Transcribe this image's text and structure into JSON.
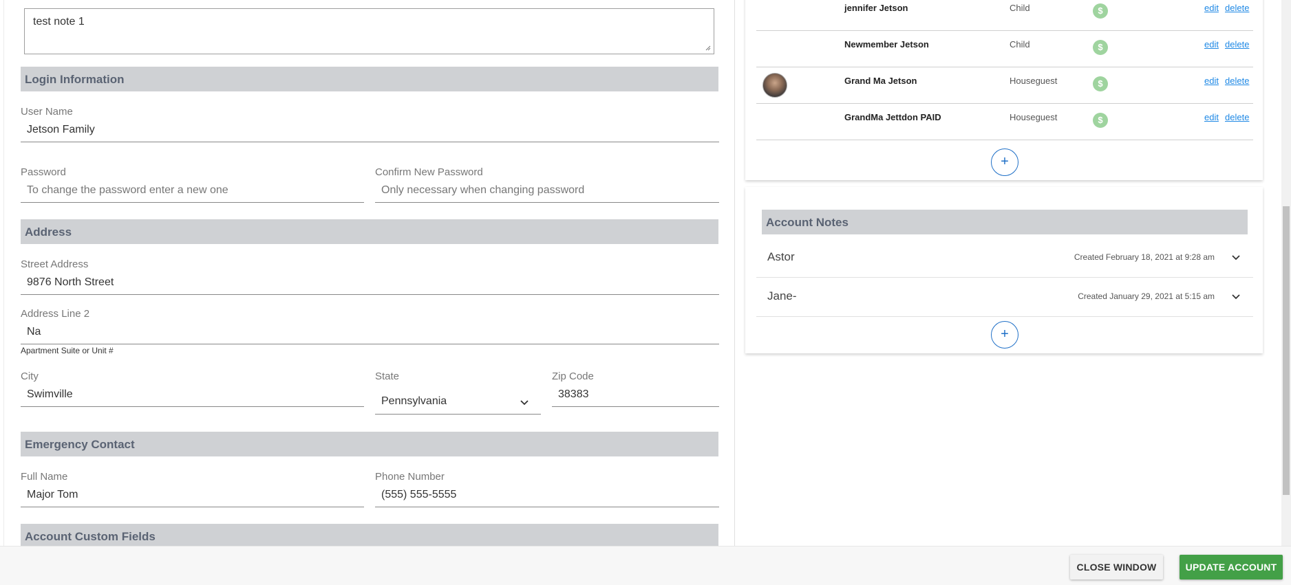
{
  "notes_textarea": {
    "value": "test note 1"
  },
  "login_section": {
    "title": "Login Information",
    "username_label": "User Name",
    "username_value": "Jetson Family",
    "password_label": "Password",
    "password_placeholder": "To change the password enter a new one",
    "confirm_label": "Confirm New Password",
    "confirm_placeholder": "Only necessary when changing password"
  },
  "address_section": {
    "title": "Address",
    "street_label": "Street Address",
    "street_value": "9876 North Street",
    "line2_label": "Address Line 2",
    "line2_value": "Na",
    "line2_hint": "Apartment Suite or Unit #",
    "city_label": "City",
    "city_value": "Swimville",
    "state_label": "State",
    "state_value": "Pennsylvania",
    "zip_label": "Zip Code",
    "zip_value": "38383"
  },
  "emergency_section": {
    "title": "Emergency Contact",
    "name_label": "Full Name",
    "name_value": "Major Tom",
    "phone_label": "Phone Number",
    "phone_value": "(555) 555-5555"
  },
  "custom_section": {
    "title": "Account Custom Fields"
  },
  "members": [
    {
      "name": "jennifer Jetson",
      "role": "Child",
      "pay_icon": "$",
      "edit": "edit",
      "delete": "delete",
      "avatar": false
    },
    {
      "name": "Newmember Jetson",
      "role": "Child",
      "pay_icon": "$",
      "edit": "edit",
      "delete": "delete",
      "avatar": false
    },
    {
      "name": "Grand Ma Jetson",
      "role": "Houseguest",
      "pay_icon": "$",
      "edit": "edit",
      "delete": "delete",
      "avatar": true
    },
    {
      "name": "GrandMa Jettdon PAID",
      "role": "Houseguest",
      "pay_icon": "$",
      "edit": "edit",
      "delete": "delete",
      "avatar": false
    }
  ],
  "add_icon": "+",
  "account_notes": {
    "title": "Account Notes",
    "items": [
      {
        "title": "Astor",
        "created": "Created February 18, 2021 at 9:28 am"
      },
      {
        "title": "Jane-",
        "created": "Created January 29, 2021 at 5:15 am"
      }
    ]
  },
  "footer": {
    "close_label": "CLOSE WINDOW",
    "update_label": "UPDATE ACCOUNT"
  },
  "colors": {
    "primary_blue": "#1e6fc7",
    "success_green": "#43a047",
    "section_gray": "#cfd1d4",
    "pay_green": "#9fd49f"
  }
}
